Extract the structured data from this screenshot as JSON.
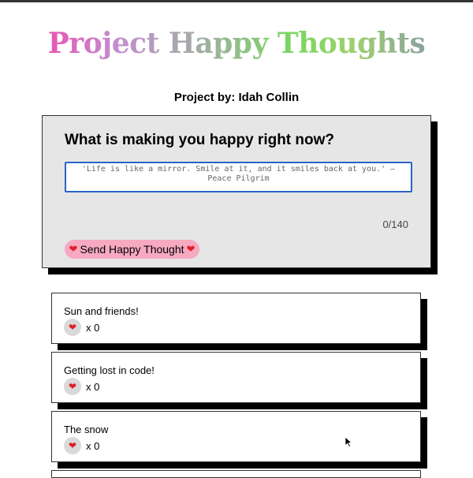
{
  "header": {
    "title": "Project Happy Thoughts",
    "byline": "Project by: Idah Collin"
  },
  "form": {
    "heading": "What is making you happy right now?",
    "placeholder": "'Life is like a mirror. Smile at it, and it smiles back at you.' – Peace Pilgrim",
    "char_count": "0/140",
    "send_label": "Send Happy Thought",
    "heart_glyph": "❤"
  },
  "thoughts": [
    {
      "text": "Sun and friends!",
      "likes": "x 0"
    },
    {
      "text": "Getting lost in code!",
      "likes": "x 0"
    },
    {
      "text": "The snow",
      "likes": "x 0"
    }
  ],
  "colors": {
    "card_bg": "#e6e6e6",
    "button_pink": "#f7a9c2",
    "heart_red": "#e0202a",
    "input_focus": "#2b64c6"
  }
}
